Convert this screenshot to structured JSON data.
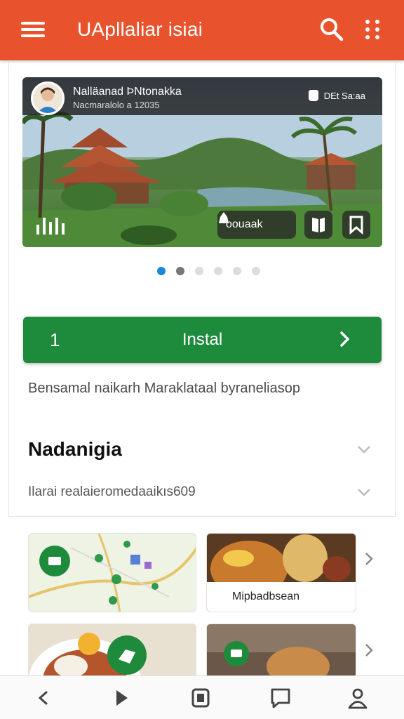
{
  "app_bar": {
    "title": "UApllaliar isiai",
    "menu_icon": "hamburger-menu-icon",
    "search_icon": "search-icon",
    "more_icon": "more-vert-icon",
    "color": "#e8532d"
  },
  "hero": {
    "name": "Nalläanad ÞNtonakka",
    "subtitle": "Nacmaralolo a 12035",
    "badge": "DEt Sa:aa",
    "pill_label": "oouaak",
    "pill_icon": "bag-icon",
    "action_icons": [
      "book-icon",
      "bookmark-icon"
    ],
    "equalizer_icon": "equalizer-icon"
  },
  "carousel": {
    "count": 6,
    "active_index": 0,
    "accent": "#1a8ad4"
  },
  "install": {
    "lead": "1",
    "label": "Instal",
    "color": "#1e8a3c"
  },
  "description": "Bensamal naikarh Maraklataal byraneliasop",
  "section": {
    "title": "Nadanigia",
    "subtitle": "Ilarai realaieromedaaikıs609"
  },
  "tiles": {
    "food_caption": "Mipbadbsean",
    "map_icon": "map-pin-icon"
  },
  "bottom_nav": {
    "items": [
      "back-icon",
      "play-icon",
      "apps-icon",
      "chat-icon",
      "profile-icon"
    ]
  }
}
